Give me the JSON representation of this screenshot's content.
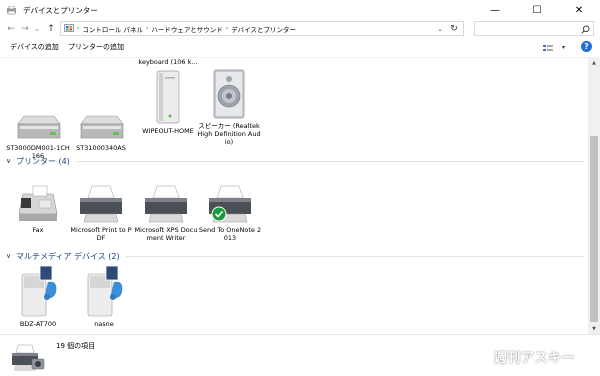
{
  "window": {
    "title": "デバイスとプリンター"
  },
  "window_controls": {
    "minimize": "—",
    "maximize": "☐",
    "close": "✕"
  },
  "nav": {
    "back": "←",
    "forward": "→",
    "recent": "⌄",
    "up": "↑"
  },
  "address": {
    "crumbs": [
      "コントロール パネル",
      "ハードウェアとサウンド",
      "デバイスとプリンター"
    ],
    "separator": "›",
    "dropdown": "⌄",
    "refresh": "↻"
  },
  "search": {
    "placeholder": ""
  },
  "toolbar": {
    "add_device": "デバイスの追加",
    "add_printer": "プリンターの追加",
    "help": "?",
    "view_caret": "▾"
  },
  "sections": [
    {
      "title": "プリンター (4)",
      "chevron": "∨"
    },
    {
      "title": "マルチメディア デバイス (2)",
      "chevron": "∨"
    }
  ],
  "devices": [
    {
      "label": "ST3000DM001-1CH166",
      "icon": "hard-drive-icon"
    },
    {
      "label": "ST31000340AS",
      "icon": "hard-drive-icon"
    },
    {
      "label": "WIPEOUT-HOME",
      "icon": "computer-tower-icon"
    },
    {
      "label": "スピーカー (Realtek High Definition Audio)",
      "icon": "speaker-icon"
    }
  ],
  "partial_item_label": "keyboard (106 k...",
  "printers": [
    {
      "label": "Fax",
      "icon": "fax-icon"
    },
    {
      "label": "Microsoft Print to PDF",
      "icon": "printer-icon"
    },
    {
      "label": "Microsoft XPS Document Writer",
      "icon": "printer-icon"
    },
    {
      "label": "Send To OneNote 2013",
      "icon": "printer-default-icon"
    }
  ],
  "multimedia": [
    {
      "label": "BDZ-AT700",
      "icon": "media-device-icon"
    },
    {
      "label": "nasne",
      "icon": "media-device-icon"
    }
  ],
  "status": {
    "text": "19 個の項目"
  },
  "watermark": "週刊アスキー",
  "colors": {
    "accent": "#1e6fd9",
    "section_title": "#1e3f7f",
    "default_check": "#1a9b3a"
  }
}
